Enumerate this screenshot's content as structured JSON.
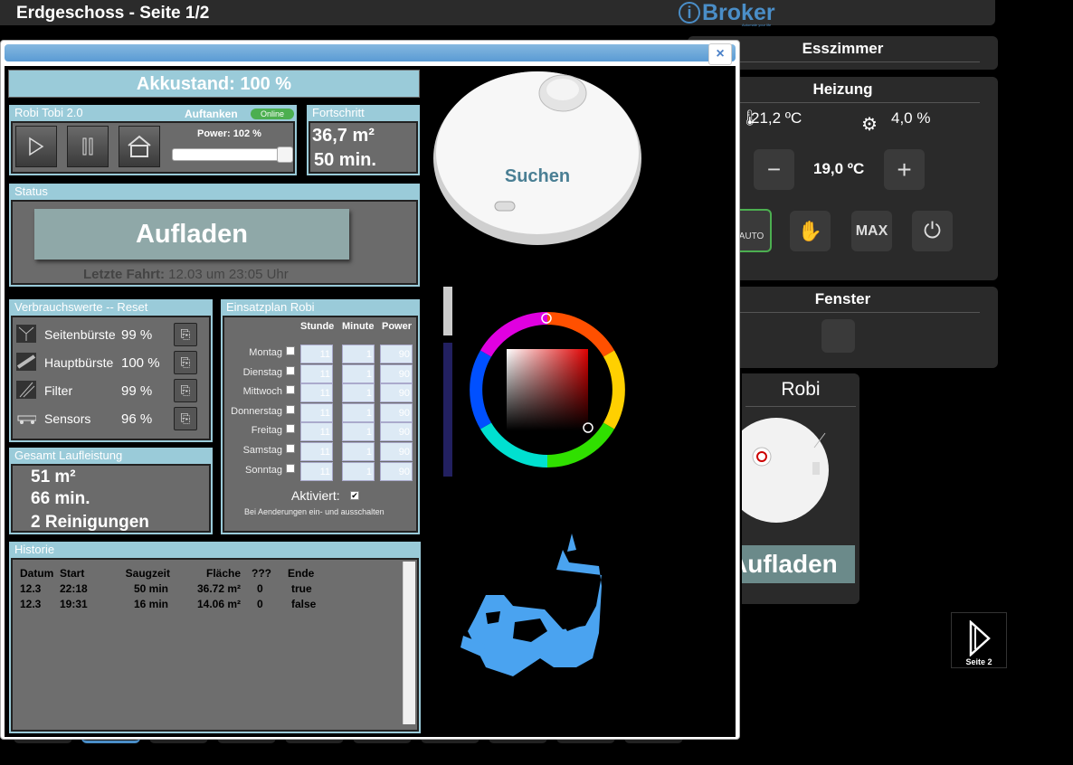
{
  "header": {
    "title": "Erdgeschoss - Seite 1/2",
    "logo_text": "Broker",
    "logo_sub": "Automate your life"
  },
  "esszimmer": {
    "title": "Esszimmer"
  },
  "heizung": {
    "title": "Heizung",
    "actual_temp": "21,2 ºC",
    "valve": "4,0 %",
    "setpoint": "19,0 ºC",
    "mode_auto": "AUTO",
    "mode_max": "MAX"
  },
  "fenster": {
    "title": "Fenster"
  },
  "robi_card": {
    "title": "Robi",
    "state": "Aufladen"
  },
  "seite2": {
    "label": "Seite 2"
  },
  "dialog": {
    "close_label": "×",
    "akku": "Akkustand: 100 %",
    "robot": {
      "name": "Robi Tobi 2.0",
      "state": "Auftanken",
      "online": "Online",
      "power_label": "Power: 102 %",
      "power_value": 102
    },
    "fortschritt": {
      "title": "Fortschritt",
      "area": "36,7 m²",
      "time": "50 min."
    },
    "status": {
      "title": "Status",
      "value": "Aufladen",
      "last_label": "Letzte Fahrt:",
      "last_value": " 12.03 um 23:05 Uhr"
    },
    "verbrauch": {
      "title": "Verbrauchswerte -- Reset",
      "items": [
        {
          "label": "Seitenbürste",
          "value": "99 %"
        },
        {
          "label": "Hauptbürste",
          "value": "100 %"
        },
        {
          "label": "Filter",
          "value": "99 %"
        },
        {
          "label": "Sensors",
          "value": "96 %"
        }
      ]
    },
    "einsatzplan": {
      "title": "Einsatzplan Robi",
      "headers": [
        "Stunde",
        "Minute",
        "Power"
      ],
      "days": [
        "Montag",
        "Dienstag",
        "Mittwoch",
        "Donnerstag",
        "Freitag",
        "Samstag",
        "Sonntag"
      ],
      "hour": "11",
      "minute": "1",
      "power": "90",
      "activated_label": "Aktiviert:",
      "hint": "Bei Aenderungen ein- und ausschalten"
    },
    "gesamt": {
      "title": "Gesamt Laufleistung",
      "area": "51 m²",
      "time": "66 min.",
      "count": "2 Reinigungen"
    },
    "historie": {
      "title": "Historie",
      "headers": [
        "Datum",
        "Start",
        "Saugzeit",
        "Fläche",
        "???",
        "Ende"
      ],
      "rows": [
        [
          "12.3",
          "22:18",
          "50 min",
          "36.72 m²",
          "0",
          "true"
        ],
        [
          "12.3",
          "19:31",
          "16 min",
          "14.06 m²",
          "0",
          "false"
        ]
      ]
    },
    "suchen": "Suchen"
  },
  "colors": {
    "accent": "#9acbd9",
    "panel_body": "#6b6b6b",
    "status": "#8fa8a8",
    "online": "#4caf50"
  }
}
